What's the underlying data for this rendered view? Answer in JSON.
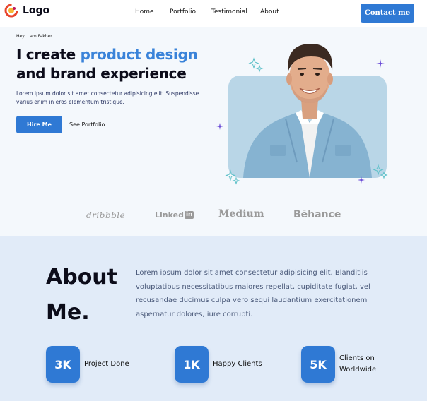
{
  "header": {
    "logo_text": "Logo",
    "nav": [
      "Home",
      "Portfolio",
      "Testimonial",
      "About"
    ],
    "contact_label": "Contact me"
  },
  "hero": {
    "greeting": "Hey, I am Fakher",
    "headline_line1_prefix": "I create ",
    "headline_line1_accent": "product design",
    "headline_line2": "and brand experience",
    "description": "Lorem ipsum dolor sit amet consectetur adipisicing elit. Suspendisse varius enim in eros elementum tristique.",
    "hire_label": "Hire Me",
    "portfolio_label": "See Portfolio"
  },
  "brands": {
    "dribbble": "dribbble",
    "linkedin_word": "Linked",
    "linkedin_box": "in",
    "medium": "Medium",
    "behance": "Bēhance"
  },
  "about": {
    "title_line1": "About",
    "title_line2": "Me.",
    "text": "Lorem ipsum dolor sit amet consectetur adipisicing elit. Blanditiis voluptatibus necessitatibus maiores repellat, cupiditate fugiat, vel recusandae ducimus culpa vero sequi laudantium exercitationem aspernatur dolores, iure corrupti."
  },
  "stats": [
    {
      "value": "3K",
      "label": "Project Done"
    },
    {
      "value": "1K",
      "label": "Happy Clients"
    },
    {
      "value": "5K",
      "label": "Clients on Worldwide"
    }
  ],
  "colors": {
    "accent": "#2f79d4",
    "headline_accent": "#3a83d9",
    "about_bg": "#e1ebf8",
    "photo_bg": "#b9d6e7"
  },
  "icons": [
    "logo-mark-icon",
    "sparkle-icon"
  ]
}
